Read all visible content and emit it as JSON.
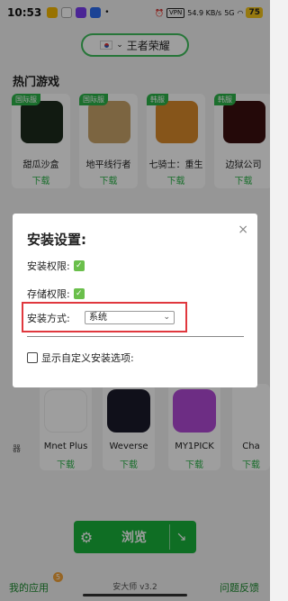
{
  "status": {
    "time": "10:53",
    "vpn": "VPN",
    "speed": "54.9 KB/s",
    "net": "5G",
    "battery": "75"
  },
  "region": {
    "flag": "kr-flag-icon",
    "label": "王者荣耀"
  },
  "hot_games": {
    "title": "热门游戏",
    "items": [
      {
        "tag": "国际服",
        "name": "甜瓜沙盒",
        "download": "下载",
        "color": "#1c2a1c"
      },
      {
        "tag": "国际服",
        "name": "地平线行者",
        "download": "下载",
        "color": "#c9a36a"
      },
      {
        "tag": "韩服",
        "name": "七骑士：重生",
        "download": "下载",
        "color": "#d98a2a"
      },
      {
        "tag": "韩服",
        "name": "边狱公司",
        "download": "下载",
        "color": "#3a1010"
      }
    ]
  },
  "apps": {
    "page": "器",
    "items": [
      {
        "name": "Mnet Plus",
        "download": "下载",
        "color": "#ffffff"
      },
      {
        "name": "Weverse",
        "download": "下载",
        "color": "#1a1a2a"
      },
      {
        "name": "MY1PICK",
        "download": "下载",
        "color": "#b04ad6"
      },
      {
        "name": "Cha",
        "download": "下载",
        "color": "#ffffff"
      }
    ]
  },
  "dialog": {
    "title": "安装设置:",
    "install_perm": "安装权限:",
    "storage_perm": "存储权限:",
    "method_label": "安装方式:",
    "method_value": "系统",
    "custom_option": "显示自定义安装选项:",
    "close": "×",
    "check": "✓"
  },
  "browse": {
    "label": "浏览",
    "gear": "⚙",
    "corner": "↘"
  },
  "bottom": {
    "my_apps": "我的应用",
    "badge": "5",
    "version": "安大师 v3.2",
    "feedback": "问题反馈"
  },
  "colors": {
    "accent": "#19b23b",
    "highlight": "#e0383e"
  }
}
